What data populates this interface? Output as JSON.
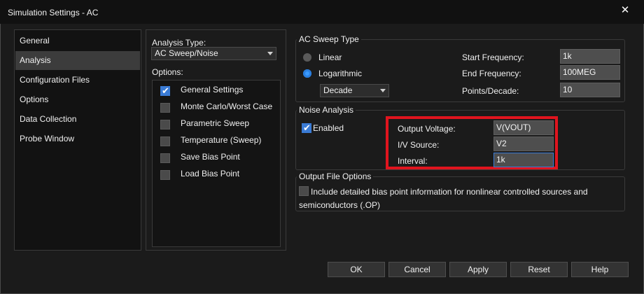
{
  "window": {
    "title": "Simulation Settings - AC",
    "close_glyph": "✕"
  },
  "nav": {
    "items": [
      {
        "label": "General",
        "selected": false
      },
      {
        "label": "Analysis",
        "selected": true
      },
      {
        "label": "Configuration Files",
        "selected": false
      },
      {
        "label": "Options",
        "selected": false
      },
      {
        "label": "Data Collection",
        "selected": false
      },
      {
        "label": "Probe Window",
        "selected": false
      }
    ]
  },
  "analysis": {
    "type_label": "Analysis Type:",
    "type_value": "AC Sweep/Noise",
    "options_label": "Options:",
    "options": [
      {
        "label": "General Settings",
        "checked": true
      },
      {
        "label": "Monte Carlo/Worst Case",
        "checked": false
      },
      {
        "label": "Parametric Sweep",
        "checked": false
      },
      {
        "label": "Temperature (Sweep)",
        "checked": false
      },
      {
        "label": "Save Bias Point",
        "checked": false
      },
      {
        "label": "Load Bias Point",
        "checked": false
      }
    ]
  },
  "ac_sweep": {
    "title": "AC Sweep Type",
    "linear_label": "Linear",
    "log_label": "Logarithmic",
    "selected": "Logarithmic",
    "log_mode": "Decade",
    "start_label": "Start Frequency:",
    "start_value": "1k",
    "end_label": "End Frequency:",
    "end_value": "100MEG",
    "points_label": "Points/Decade:",
    "points_value": "10"
  },
  "noise": {
    "title": "Noise Analysis",
    "enabled_label": "Enabled",
    "enabled": true,
    "output_voltage_label": "Output Voltage:",
    "output_voltage_value": "V(VOUT)",
    "iv_source_label": "I/V Source:",
    "iv_source_value": "V2",
    "interval_label": "Interval:",
    "interval_value": "1k"
  },
  "output_file": {
    "title": "Output File Options",
    "bias_label_line1": "Include detailed bias point information for nonlinear controlled sources and",
    "bias_label_line2": "semiconductors (.OP)",
    "bias_checked": false
  },
  "buttons": {
    "ok": "OK",
    "cancel": "Cancel",
    "apply": "Apply",
    "reset": "Reset",
    "help": "Help"
  },
  "colors": {
    "highlight": "#e0141e",
    "accent": "#3a7bd5"
  }
}
